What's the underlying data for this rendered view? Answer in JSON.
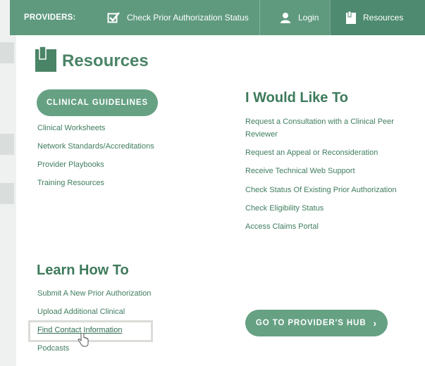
{
  "nav": {
    "label": "PROVIDERS:",
    "auth_status": "Check Prior Authorization Status",
    "login": "Login",
    "resources": "Resources"
  },
  "panel": {
    "title": "Resources",
    "guidelines_button": "CLINICAL GUIDELINES",
    "guideline_links": [
      "Clinical Worksheets",
      "Network Standards/Accreditations",
      "Provider Playbooks",
      "Training Resources"
    ],
    "like_title": "I Would Like To",
    "like_links": [
      "Request a Consultation with a Clinical Peer",
      "Reviewer",
      "Request an Appeal or Reconsideration",
      "Receive Technical Web Support",
      "Check Status Of Existing Prior Authorization",
      "Check Eligibility Status",
      "Access Claims Portal"
    ],
    "learn_title": "Learn How To",
    "learn_links": [
      "Submit A New Prior Authorization",
      "Upload Additional Clinical",
      "Find Contact Information",
      "Podcasts"
    ],
    "hub_button": "GO TO PROVIDER'S HUB",
    "hub_chevron": "›"
  },
  "colors": {
    "nav": "#5f9a7f",
    "accent": "#66a184",
    "link": "#3f7d5f"
  },
  "icons": [
    "checkbox-icon",
    "user-icon",
    "book-icon",
    "cursor-hand-icon"
  ]
}
